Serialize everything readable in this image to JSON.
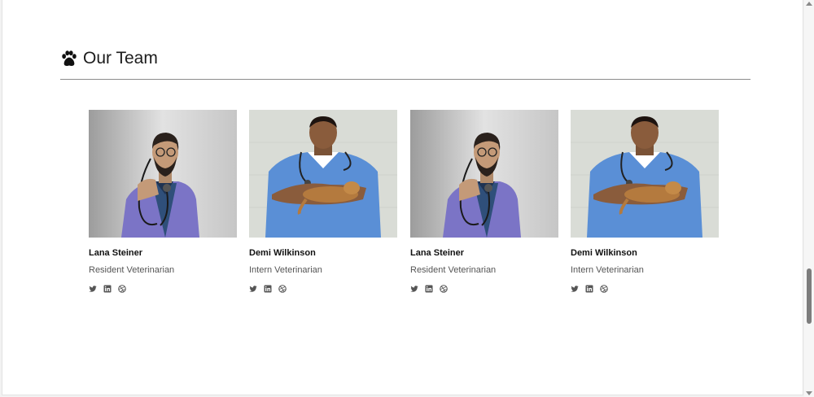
{
  "section": {
    "title": "Our Team",
    "icon": "paw-icon"
  },
  "team": [
    {
      "name": "Lana Steiner",
      "role": "Resident Veterinarian",
      "photo": "bearded-vet-with-stethoscope"
    },
    {
      "name": "Demi Wilkinson",
      "role": "Intern Veterinarian",
      "photo": "vet-in-scrubs-holding-puppy"
    },
    {
      "name": "Lana Steiner",
      "role": "Resident Veterinarian",
      "photo": "bearded-vet-with-stethoscope"
    },
    {
      "name": "Demi Wilkinson",
      "role": "Intern Veterinarian",
      "photo": "vet-in-scrubs-holding-puppy"
    }
  ],
  "social_icons": [
    "twitter-icon",
    "linkedin-icon",
    "dribbble-icon"
  ],
  "colors": {
    "icon": "#555555",
    "scrubs": "#5a8fd6",
    "coat": "#7b74c6"
  }
}
